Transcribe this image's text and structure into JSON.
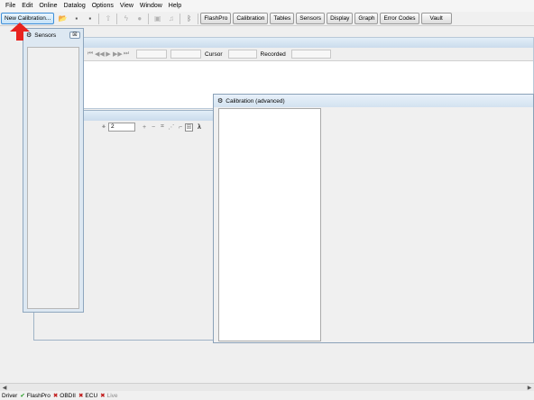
{
  "menu": [
    "File",
    "Edit",
    "Online",
    "Datalog",
    "Options",
    "View",
    "Window",
    "Help"
  ],
  "toolbar": {
    "new_calibration": "New Calibration...",
    "buttons": [
      "FlashPro",
      "Calibration",
      "Tables",
      "Sensors",
      "Display",
      "Graph",
      "Error Codes",
      "Vault"
    ]
  },
  "datalog": {
    "cursor_label": "Cursor",
    "recorded_label": "Recorded"
  },
  "tables": {
    "value": "2"
  },
  "sensors": {
    "title": "Sensors",
    "close": "☒"
  },
  "calibration": {
    "title": "Calibration (advanced)"
  },
  "status": {
    "driver_label": "Driver",
    "flashpro_label": "FlashPro",
    "obdii_label": "OBDII",
    "ecu_label": "ECU",
    "live_label": "Live"
  },
  "colors": {
    "accent": "#3d8ed8",
    "ok": "#1c9a1c",
    "error": "#c01818",
    "arrow": "#e8231f"
  }
}
